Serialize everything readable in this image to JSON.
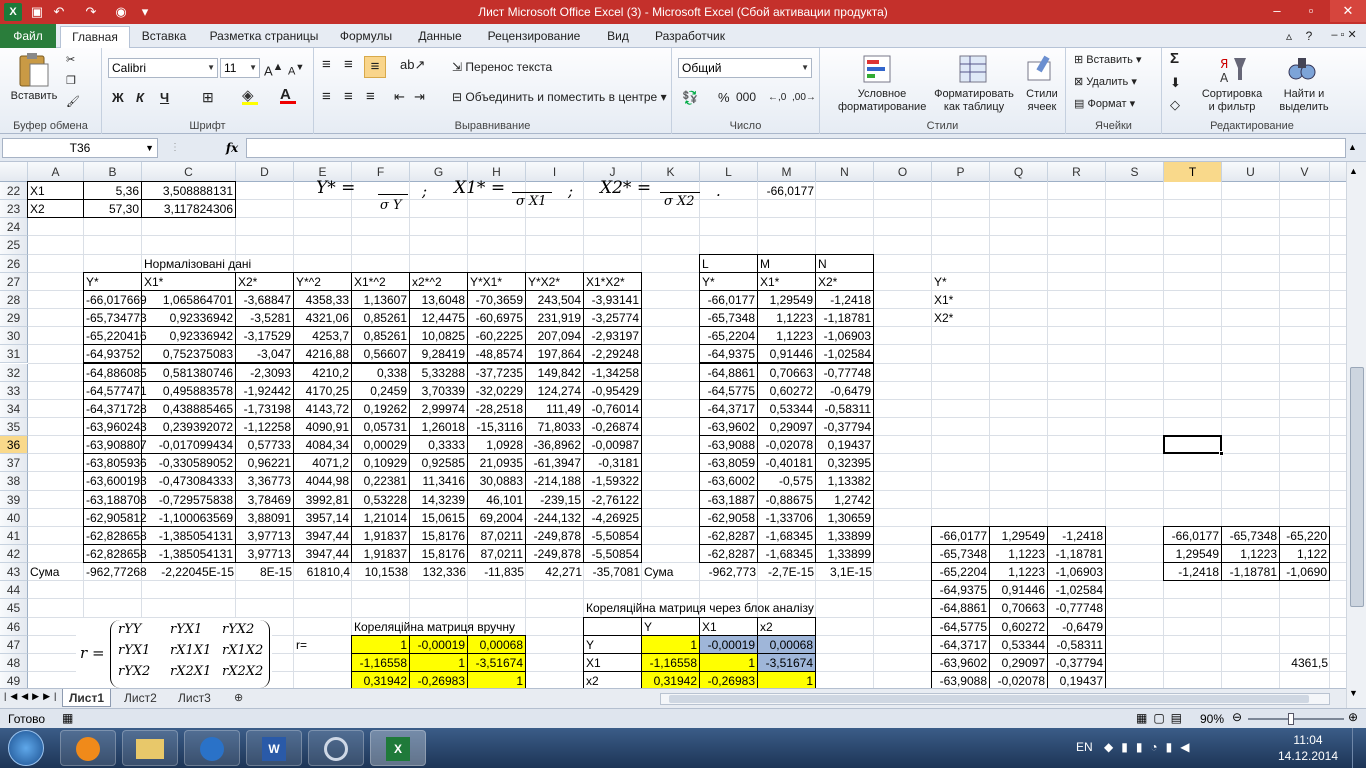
{
  "window": {
    "title": "Лист Microsoft Office Excel (3)  -  Microsoft Excel (Сбой активации продукта)"
  },
  "tabs": [
    "Файл",
    "Главная",
    "Вставка",
    "Разметка страницы",
    "Формулы",
    "Данные",
    "Рецензирование",
    "Вид",
    "Разработчик"
  ],
  "ribbon": {
    "clipboard": {
      "paste": "Вставить",
      "group": "Буфер обмена"
    },
    "font": {
      "name": "Calibri",
      "size": "11",
      "bold": "Ж",
      "italic": "К",
      "underline": "Ч",
      "group": "Шрифт"
    },
    "alignment": {
      "wrap": "Перенос текста",
      "merge": "Объединить и поместить в центре",
      "group": "Выравнивание"
    },
    "number": {
      "format": "Общий",
      "percent": "%",
      "thousands": "000",
      "group": "Число"
    },
    "styles": {
      "conditional": "Условное\nформатирование",
      "astable": "Форматировать\nкак таблицу",
      "cellstyles": "Стили\nячеек",
      "group": "Стили"
    },
    "cells": {
      "insert": "Вставить",
      "delete": "Удалить",
      "format": "Формат",
      "group": "Ячейки"
    },
    "editing": {
      "sum": "Σ",
      "sort": "Сортировка\nи фильтр",
      "find": "Найти и\nвыделить",
      "group": "Редактирование"
    }
  },
  "formula_bar": {
    "name_box": "T36",
    "fx": "fx",
    "content": ""
  },
  "columns": [
    "A",
    "B",
    "C",
    "D",
    "E",
    "F",
    "G",
    "H",
    "I",
    "J",
    "K",
    "L",
    "M",
    "N",
    "O",
    "P",
    "Q",
    "R",
    "S",
    "T",
    "U",
    "V"
  ],
  "rows": [
    "22",
    "23",
    "24",
    "25",
    "26",
    "27",
    "28",
    "29",
    "30",
    "31",
    "32",
    "33",
    "34",
    "35",
    "36",
    "37",
    "38",
    "39",
    "40",
    "41",
    "42",
    "43",
    "44",
    "45",
    "46",
    "47",
    "48",
    "49"
  ],
  "selected": {
    "column": "T",
    "row": "36"
  },
  "top_rows": [
    {
      "A": "X1",
      "B": "5,36",
      "C": "3,508888131",
      "M": "-66,0177"
    },
    {
      "A": "X2",
      "B": "57,30",
      "C": "3,117824306"
    }
  ],
  "formula_images": {
    "y": "Y* =",
    "sy": "σ Y",
    "x1": "X1* =",
    "sx1": "σ X1",
    "x2": "X2* =",
    "sx2": "σ X2",
    "sep": ";",
    "dot": "."
  },
  "main_table": {
    "title": "Нормалізовані дані",
    "headers": [
      "Y*",
      "X1*",
      "X2*",
      "Y*^2",
      "X1*^2",
      "x2*^2",
      "Y*X1*",
      "Y*X2*",
      "X1*X2*"
    ],
    "rows": [
      [
        "-66,017669",
        "1,065864701",
        "-3,68847",
        "4358,33",
        "1,13607",
        "13,6048",
        "-70,3659",
        "243,504",
        "-3,93141"
      ],
      [
        "-65,734773",
        "0,92336942",
        "-3,5281",
        "4321,06",
        "0,85261",
        "12,4475",
        "-60,6975",
        "231,919",
        "-3,25774"
      ],
      [
        "-65,220416",
        "0,92336942",
        "-3,17529",
        "4253,7",
        "0,85261",
        "10,0825",
        "-60,2225",
        "207,094",
        "-2,93197"
      ],
      [
        "-64,93752",
        "0,752375083",
        "-3,047",
        "4216,88",
        "0,56607",
        "9,28419",
        "-48,8574",
        "197,864",
        "-2,29248"
      ],
      [
        "-64,886085",
        "0,581380746",
        "-2,3093",
        "4210,2",
        "0,338",
        "5,33288",
        "-37,7235",
        "149,842",
        "-1,34258"
      ],
      [
        "-64,577471",
        "0,495883578",
        "-1,92442",
        "4170,25",
        "0,2459",
        "3,70339",
        "-32,0229",
        "124,274",
        "-0,95429"
      ],
      [
        "-64,371728",
        "0,438885465",
        "-1,73198",
        "4143,72",
        "0,19262",
        "2,99974",
        "-28,2518",
        "111,49",
        "-0,76014"
      ],
      [
        "-63,960243",
        "0,239392072",
        "-1,12258",
        "4090,91",
        "0,05731",
        "1,26018",
        "-15,3116",
        "71,8033",
        "-0,26874"
      ],
      [
        "-63,908807",
        "-0,017099434",
        "0,57733",
        "4084,34",
        "0,00029",
        "0,3333",
        "1,0928",
        "-36,8962",
        "-0,00987"
      ],
      [
        "-63,805936",
        "-0,330589052",
        "0,96221",
        "4071,2",
        "0,10929",
        "0,92585",
        "21,0935",
        "-61,3947",
        "-0,3181"
      ],
      [
        "-63,600193",
        "-0,473084333",
        "3,36773",
        "4044,98",
        "0,22381",
        "11,3416",
        "30,0883",
        "-214,188",
        "-1,59322"
      ],
      [
        "-63,188708",
        "-0,729575838",
        "3,78469",
        "3992,81",
        "0,53228",
        "14,3239",
        "46,101",
        "-239,15",
        "-2,76122"
      ],
      [
        "-62,905812",
        "-1,100063569",
        "3,88091",
        "3957,14",
        "1,21014",
        "15,0615",
        "69,2004",
        "-244,132",
        "-4,26925"
      ],
      [
        "-62,828658",
        "-1,385054131",
        "3,97713",
        "3947,44",
        "1,91837",
        "15,8176",
        "87,0211",
        "-249,878",
        "-5,50854"
      ],
      [
        "-62,828658",
        "-1,385054131",
        "3,97713",
        "3947,44",
        "1,91837",
        "15,8176",
        "87,0211",
        "-249,878",
        "-5,50854"
      ]
    ],
    "sum_label": "Сума",
    "sum": [
      "-962,77268",
      "-2,22045E-15",
      "8E-15",
      "61810,4",
      "10,1538",
      "132,336",
      "-11,835",
      "42,271",
      "-35,7081"
    ]
  },
  "right_table": {
    "letters": [
      "L",
      "M",
      "N"
    ],
    "headers": [
      "Y*",
      "X1*",
      "X2*"
    ],
    "rows": [
      [
        "-66,0177",
        "1,29549",
        "-1,2418"
      ],
      [
        "-65,7348",
        "1,1223",
        "-1,18781"
      ],
      [
        "-65,2204",
        "1,1223",
        "-1,06903"
      ],
      [
        "-64,9375",
        "0,91446",
        "-1,02584"
      ],
      [
        "-64,8861",
        "0,70663",
        "-0,77748"
      ],
      [
        "-64,5775",
        "0,60272",
        "-0,6479"
      ],
      [
        "-64,3717",
        "0,53344",
        "-0,58311"
      ],
      [
        "-63,9602",
        "0,29097",
        "-0,37794"
      ],
      [
        "-63,9088",
        "-0,02078",
        "0,19437"
      ],
      [
        "-63,8059",
        "-0,40181",
        "0,32395"
      ],
      [
        "-63,6002",
        "-0,575",
        "1,13382"
      ],
      [
        "-63,1887",
        "-0,88675",
        "1,2742"
      ],
      [
        "-62,9058",
        "-1,33706",
        "1,30659"
      ],
      [
        "-62,8287",
        "-1,68345",
        "1,33899"
      ],
      [
        "-62,8287",
        "-1,68345",
        "1,33899"
      ]
    ],
    "sum_label": "Сума",
    "sum": [
      "-962,773",
      "-2,7E-15",
      "3,1E-15"
    ]
  },
  "p_labels": [
    "Y*",
    "X1*",
    "X2*"
  ],
  "pqr_table": [
    [
      "-66,0177",
      "1,29549",
      "-1,2418"
    ],
    [
      "-65,7348",
      "1,1223",
      "-1,18781"
    ],
    [
      "-65,2204",
      "1,1223",
      "-1,06903"
    ],
    [
      "-64,9375",
      "0,91446",
      "-1,02584"
    ],
    [
      "-64,8861",
      "0,70663",
      "-0,77748"
    ],
    [
      "-64,5775",
      "0,60272",
      "-0,6479"
    ],
    [
      "-64,3717",
      "0,53344",
      "-0,58311"
    ],
    [
      "-63,9602",
      "0,29097",
      "-0,37794"
    ],
    [
      "-63,9088",
      "-0,02078",
      "0,19437"
    ]
  ],
  "transposed": [
    [
      "-66,0177",
      "-65,7348",
      "-65,220"
    ],
    [
      "1,29549",
      "1,1223",
      "1,122"
    ],
    [
      "-1,2418",
      "-1,18781",
      "-1,0690"
    ]
  ],
  "v48": "4361,5",
  "corr_manual": {
    "title": "Кореляційна матриця вручну",
    "r_label": "r=",
    "rows": [
      [
        "1",
        "-0,00019",
        "0,00068"
      ],
      [
        "-1,16558",
        "1",
        "-3,51674"
      ],
      [
        "0,31942",
        "-0,26983",
        "1"
      ]
    ]
  },
  "corr_analysis": {
    "title": "Кореляційна матриця через блок аналізу",
    "cols": [
      "Y",
      "X1",
      "x2"
    ],
    "rowlabels": [
      "Y",
      "X1",
      "x2"
    ],
    "rows": [
      [
        "1",
        "-0,00019",
        "0,00068"
      ],
      [
        "-1,16558",
        "1",
        "-3,51674"
      ],
      [
        "0,31942",
        "-0,26983",
        "1"
      ]
    ]
  },
  "matrix_formula": {
    "r": "r =",
    "rows": [
      [
        "rYY",
        "rYX1",
        "rYX2"
      ],
      [
        "rYX1",
        "rX1X1",
        "rX1X2"
      ],
      [
        "rYX2",
        "rX2X1",
        "rX2X2"
      ]
    ]
  },
  "sheets": [
    "Лист1",
    "Лист2",
    "Лист3"
  ],
  "status": {
    "ready": "Готово",
    "zoom": "90%"
  },
  "taskbar": {
    "lang": "EN",
    "time": "11:04",
    "date": "14.12.2014"
  }
}
